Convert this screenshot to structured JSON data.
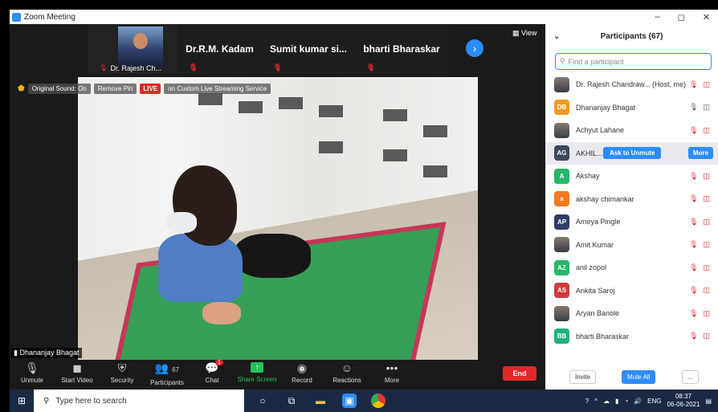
{
  "window": {
    "title": "Zoom Meeting",
    "controls": [
      "–",
      "◻",
      "✕"
    ]
  },
  "thumbnails": [
    {
      "type": "camera",
      "label": "Dr. Rajesh Ch..."
    },
    {
      "type": "name",
      "name": "Dr.R.M. Kadam"
    },
    {
      "type": "name",
      "name": "Sumit kumar si..."
    },
    {
      "type": "name",
      "name": "bharti Bharaskar"
    }
  ],
  "view_label": "View",
  "overlay": {
    "original_sound": "Original Sound: On",
    "remove_pin": "Remove Pin",
    "live": "LIVE",
    "streaming": "on Custom Live Streaming Service"
  },
  "active_speaker": "Dhananjay Bhagat",
  "toolbar": {
    "unmute": "Unmute",
    "start_video": "Start Video",
    "security": "Security",
    "participants": "Participants",
    "participants_count": "67",
    "chat": "Chat",
    "chat_badge": "1",
    "share_screen": "Share Screen",
    "record": "Record",
    "reactions": "Reactions",
    "more": "More",
    "end": "End"
  },
  "panel": {
    "title": "Participants (67)",
    "search_placeholder": "Find a participant",
    "ask_unmute": "Ask to Unmute",
    "more": "More",
    "invite": "Invite",
    "mute_all": "Mute All",
    "ellipsis": "...",
    "participants": [
      {
        "initials": "",
        "color": "#6b5a4a",
        "photo": true,
        "name": "Dr. Rajesh Chandraw... (Host, me)",
        "state": "muted"
      },
      {
        "initials": "DB",
        "color": "#f29a1e",
        "photo": false,
        "name": "Dhananjay Bhagat",
        "state": "active"
      },
      {
        "initials": "",
        "color": "#5a4a3a",
        "photo": true,
        "name": "Achyut Lahane",
        "state": "muted"
      },
      {
        "initials": "AG",
        "color": "#3a4a5c",
        "photo": false,
        "name": "AKHIL...",
        "state": "hover"
      },
      {
        "initials": "A",
        "color": "#25b866",
        "photo": false,
        "name": "Akshay",
        "state": "muted"
      },
      {
        "initials": "a",
        "color": "#f27a1e",
        "photo": false,
        "name": "akshay chimankar",
        "state": "muted"
      },
      {
        "initials": "AP",
        "color": "#2c3e66",
        "photo": false,
        "name": "Ameya Pingle",
        "state": "muted"
      },
      {
        "initials": "",
        "color": "#8a7a6a",
        "photo": true,
        "name": "Amit Kumar",
        "state": "muted"
      },
      {
        "initials": "AZ",
        "color": "#25b866",
        "photo": false,
        "name": "anil zopol",
        "state": "muted"
      },
      {
        "initials": "AS",
        "color": "#d13a3a",
        "photo": false,
        "name": "Ankita Saroj",
        "state": "muted"
      },
      {
        "initials": "",
        "color": "#3a5a8a",
        "photo": true,
        "name": "Aryan Banole",
        "state": "muted"
      },
      {
        "initials": "BB",
        "color": "#1fb07a",
        "photo": false,
        "name": "bharti Bharaskar",
        "state": "muted"
      }
    ]
  },
  "taskbar": {
    "search_placeholder": "Type here to search",
    "lang": "ENG",
    "time": "08:37",
    "date": "06-06-2021"
  }
}
